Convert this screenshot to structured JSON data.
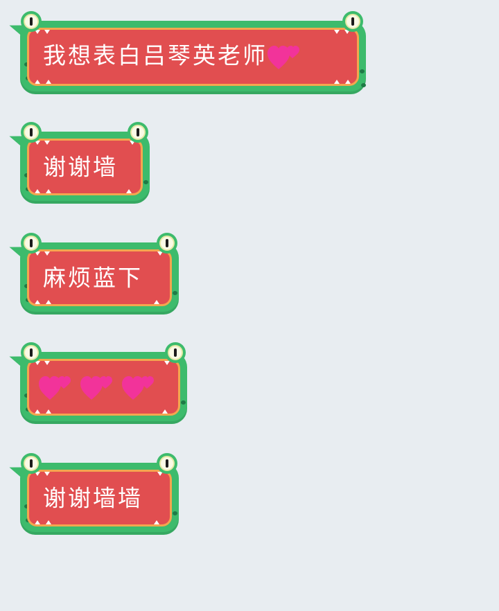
{
  "messages": [
    {
      "text": "我想表白吕琴英老师",
      "trailing_emoji": "two-hearts"
    },
    {
      "text": "谢谢墙",
      "trailing_emoji": ""
    },
    {
      "text": "麻烦蓝下",
      "trailing_emoji": ""
    },
    {
      "text": "",
      "emojis": [
        "two-hearts",
        "two-hearts",
        "two-hearts"
      ]
    },
    {
      "text": "谢谢墙墙",
      "trailing_emoji": ""
    }
  ],
  "colors": {
    "background": "#e8edf1",
    "bubble_green": "#3dbb6c",
    "bubble_red": "#e14e50",
    "bubble_border": "#f4a64f",
    "heart_pink": "#f2339a"
  }
}
